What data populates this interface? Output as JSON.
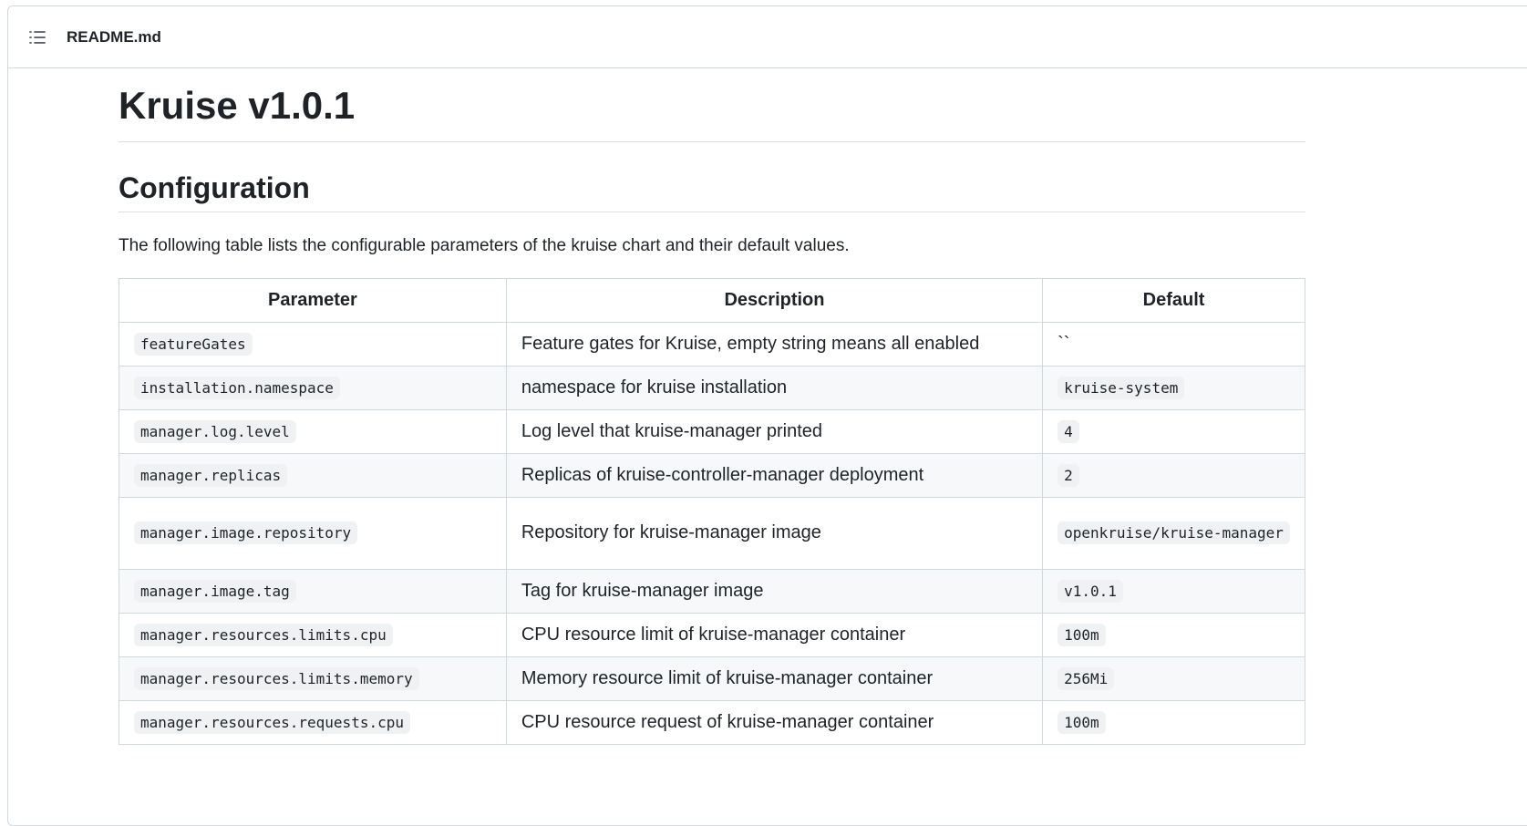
{
  "file": {
    "name": "README.md",
    "toc_icon": "list-unordered-icon"
  },
  "readme": {
    "title": "Kruise v1.0.1",
    "section_title": "Configuration",
    "intro": "The following table lists the configurable parameters of the kruise chart and their default values."
  },
  "table": {
    "headers": [
      "Parameter",
      "Description",
      "Default"
    ],
    "rows": [
      {
        "param": "featureGates",
        "desc": "Feature gates for Kruise, empty string means all enabled",
        "default": "``",
        "default_is_code": false
      },
      {
        "param": "installation.namespace",
        "desc": "namespace for kruise installation",
        "default": "kruise-system",
        "default_is_code": true
      },
      {
        "param": "manager.log.level",
        "desc": "Log level that kruise-manager printed",
        "default": "4",
        "default_is_code": true
      },
      {
        "param": "manager.replicas",
        "desc": "Replicas of kruise-controller-manager deployment",
        "default": "2",
        "default_is_code": true
      },
      {
        "param": "manager.image.repository",
        "desc": "Repository for kruise-manager image",
        "default": "openkruise/kruise-manager",
        "default_is_code": true
      },
      {
        "param": "manager.image.tag",
        "desc": "Tag for kruise-manager image",
        "default": "v1.0.1",
        "default_is_code": true
      },
      {
        "param": "manager.resources.limits.cpu",
        "desc": "CPU resource limit of kruise-manager container",
        "default": "100m",
        "default_is_code": true
      },
      {
        "param": "manager.resources.limits.memory",
        "desc": "Memory resource limit of kruise-manager container",
        "default": "256Mi",
        "default_is_code": true
      },
      {
        "param": "manager.resources.requests.cpu",
        "desc": "CPU resource request of kruise-manager container",
        "default": "100m",
        "default_is_code": true
      }
    ]
  }
}
